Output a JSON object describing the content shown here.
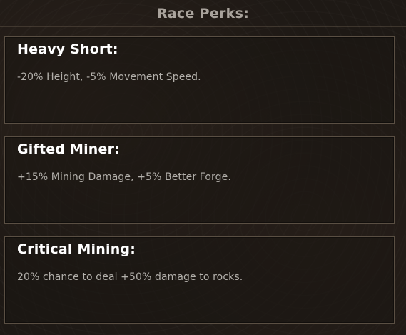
{
  "header": {
    "title": "Race Perks:"
  },
  "perks": [
    {
      "title": "Heavy Short:",
      "description": "-20% Height, -5% Movement Speed."
    },
    {
      "title": "Gifted Miner:",
      "description": "+15% Mining Damage, +5% Better Forge."
    },
    {
      "title": "Critical Mining:",
      "description": "20% chance to deal +50% damage to rocks."
    }
  ],
  "colors": {
    "background": "#1e1915",
    "card_border": "#5a4f43",
    "title_text": "#ffffff",
    "body_text": "#b3b0ab",
    "header_text": "#a9a39c"
  }
}
